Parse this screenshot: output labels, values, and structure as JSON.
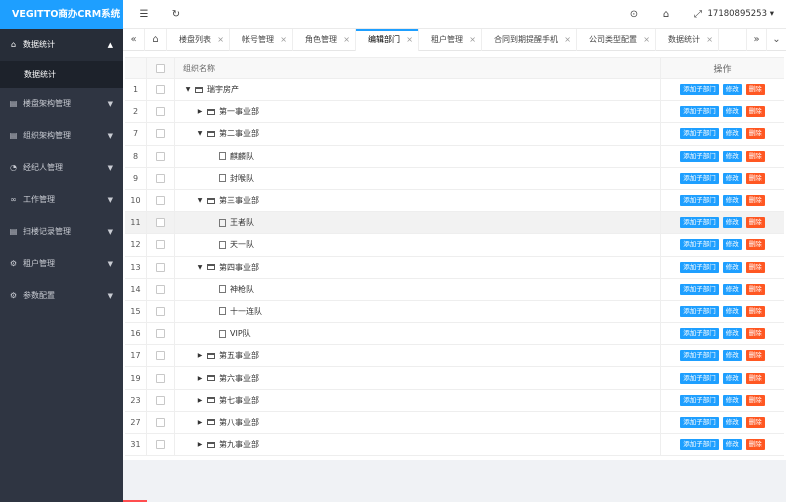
{
  "app": {
    "title": "VEGITTO商办CRM系统"
  },
  "header": {
    "user": "17180895253"
  },
  "sidebar": {
    "items": [
      {
        "label": "数据统计",
        "icon": "home-icon",
        "expanded": true,
        "children": [
          {
            "label": "数据统计"
          }
        ]
      },
      {
        "label": "楼盘架构管理",
        "icon": "list-icon"
      },
      {
        "label": "组织架构管理",
        "icon": "list-icon"
      },
      {
        "label": "经纪人管理",
        "icon": "user-icon"
      },
      {
        "label": "工作管理",
        "icon": "link-icon"
      },
      {
        "label": "扫楼记录管理",
        "icon": "list-icon"
      },
      {
        "label": "租户管理",
        "icon": "gear-icon"
      },
      {
        "label": "参数配置",
        "icon": "gear-icon"
      }
    ]
  },
  "tabs": [
    {
      "label": "楼盘列表"
    },
    {
      "label": "帐号管理"
    },
    {
      "label": "角色管理"
    },
    {
      "label": "编辑部门",
      "active": true
    },
    {
      "label": "租户管理"
    },
    {
      "label": "合同到期提醒手机"
    },
    {
      "label": "公司类型配置"
    },
    {
      "label": "数据统计"
    }
  ],
  "table": {
    "headers": {
      "name": "组织名称",
      "ops": "操作"
    },
    "rows": [
      {
        "num": "1",
        "name": "瑞宇房产",
        "level": 0,
        "type": "folder",
        "expanded": true
      },
      {
        "num": "2",
        "name": "第一事业部",
        "level": 1,
        "type": "folder",
        "expanded": false
      },
      {
        "num": "7",
        "name": "第二事业部",
        "level": 1,
        "type": "folder",
        "expanded": true
      },
      {
        "num": "8",
        "name": "麒麟队",
        "level": 2,
        "type": "file"
      },
      {
        "num": "9",
        "name": "封喉队",
        "level": 2,
        "type": "file"
      },
      {
        "num": "10",
        "name": "第三事业部",
        "level": 1,
        "type": "folder",
        "expanded": true
      },
      {
        "num": "11",
        "name": "王者队",
        "level": 2,
        "type": "file",
        "hover": true
      },
      {
        "num": "12",
        "name": "天一队",
        "level": 2,
        "type": "file"
      },
      {
        "num": "13",
        "name": "第四事业部",
        "level": 1,
        "type": "folder",
        "expanded": true
      },
      {
        "num": "14",
        "name": "神枪队",
        "level": 2,
        "type": "file"
      },
      {
        "num": "15",
        "name": "十一连队",
        "level": 2,
        "type": "file"
      },
      {
        "num": "16",
        "name": "VIP队",
        "level": 2,
        "type": "file"
      },
      {
        "num": "17",
        "name": "第五事业部",
        "level": 1,
        "type": "folder",
        "expanded": false
      },
      {
        "num": "19",
        "name": "第六事业部",
        "level": 1,
        "type": "folder",
        "expanded": false
      },
      {
        "num": "23",
        "name": "第七事业部",
        "level": 1,
        "type": "folder",
        "expanded": false
      },
      {
        "num": "27",
        "name": "第八事业部",
        "level": 1,
        "type": "folder",
        "expanded": false
      },
      {
        "num": "31",
        "name": "第九事业部",
        "level": 1,
        "type": "folder",
        "expanded": false
      }
    ],
    "actions": {
      "add": "添加子部门",
      "edit": "修改",
      "delete": "删除"
    }
  },
  "colors": {
    "primary": "#1e9fff",
    "danger": "#ff5722",
    "sidebar": "#2f3542"
  }
}
